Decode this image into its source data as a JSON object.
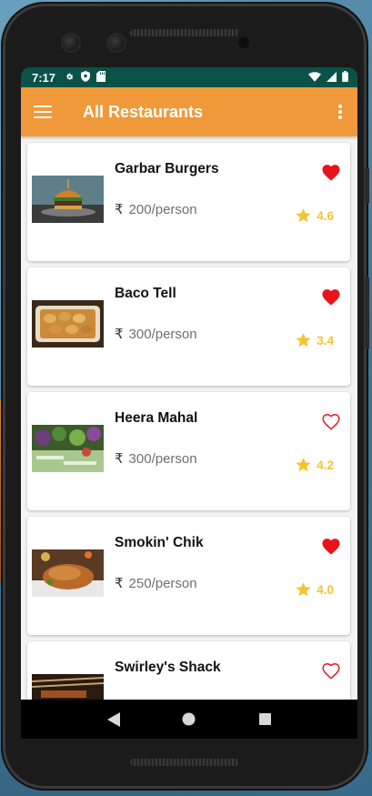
{
  "status_bar": {
    "time": "7:17"
  },
  "app_bar": {
    "title": "All Restaurants",
    "menu_icon": "hamburger-menu-icon",
    "overflow_icon": "more-vert-icon"
  },
  "restaurants": [
    {
      "name": "Garbar Burgers",
      "price": "200/person",
      "rating": "4.6",
      "favorite": true,
      "image": "burger-image"
    },
    {
      "name": "Baco Tell",
      "price": "300/person",
      "rating": "3.4",
      "favorite": true,
      "image": "tacos-image"
    },
    {
      "name": "Heera Mahal",
      "price": "300/person",
      "rating": "4.2",
      "favorite": false,
      "image": "vegetables-image"
    },
    {
      "name": "Smokin' Chik",
      "price": "250/person",
      "rating": "4.0",
      "favorite": true,
      "image": "roast-chicken-image"
    },
    {
      "name": "Swirley's Shack",
      "price": "",
      "rating": "",
      "favorite": false,
      "image": "skewers-image"
    }
  ],
  "currency_symbol": "₹",
  "colors": {
    "appbar": "#f0993a",
    "statusbar": "#0a5248",
    "heart": "#e8141b",
    "star": "#f4c430"
  }
}
